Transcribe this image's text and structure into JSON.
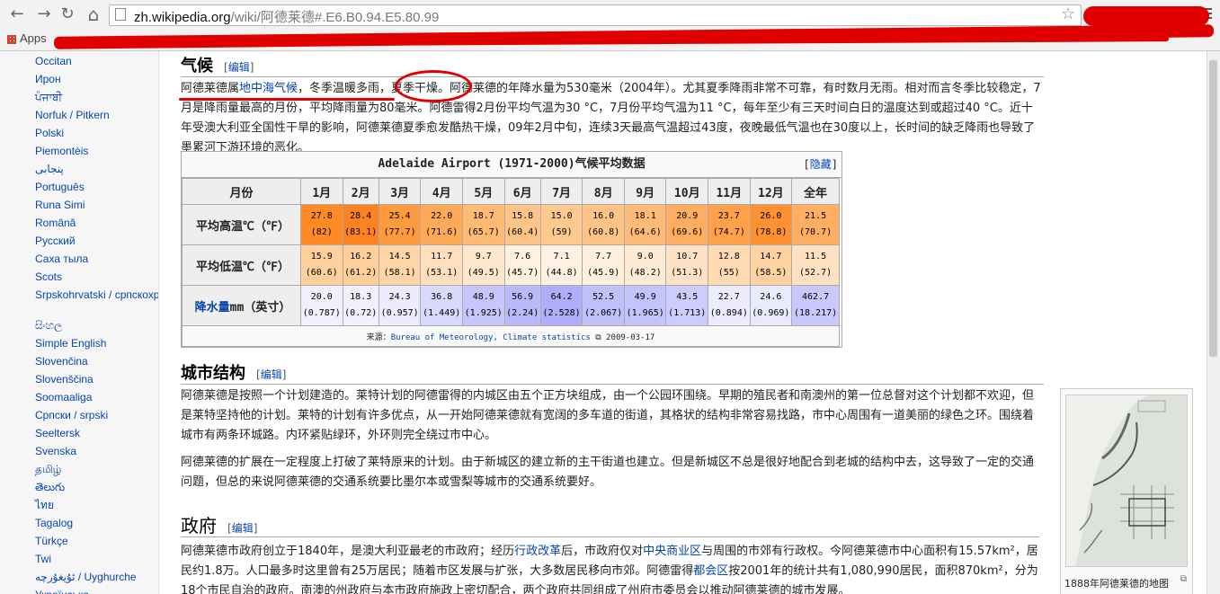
{
  "browser": {
    "url_host": "zh.wikipedia.org",
    "url_path": "/wiki/阿德莱德#.E6.B0.94.E5.80.99",
    "bookmarks_apps": "Apps",
    "back": "←",
    "forward": "→",
    "reload": "↻",
    "home": "⌂",
    "star": "☆"
  },
  "sidebar": {
    "languages": [
      "Occitan",
      "Ирон",
      "ਪੰਜਾਬੀ",
      "Norfuk / Pitkern",
      "Polski",
      "Piemontèis",
      "پنجابی",
      "Português",
      "Runa Simi",
      "Română",
      "Русский",
      "Саха тыла",
      "Scots",
      "Srpskohrvatski / српскохрватски",
      "සිංහල",
      "Simple English",
      "Slovenčina",
      "Slovenščina",
      "Soomaaliga",
      "Српски / srpski",
      "Seeltersk",
      "Svenska",
      "தமிழ்",
      "తెలుగు",
      "ไทย",
      "Tagalog",
      "Türkçe",
      "Twi",
      "ئۇيغۇرچە / Uyghurche",
      "Українська"
    ]
  },
  "content": {
    "climate_heading": "气候",
    "edit_label": "编辑",
    "climate_para": {
      "p1": "阿德莱德属",
      "link": "地中海气候",
      "p2": "，冬季温暖多雨，夏季干燥。阿德莱德的年降水量为530毫米（2004年）。尤其夏季降雨非常不可靠，有时数月无雨。相对而言冬季比较稳定，7月是降雨量最高的月份，平均降雨量为80毫米。阿德雷得2月份平均气温为30 °C，7月份平均气温为11 °C，每年至少有三天时间白日的温度达到或超过40 °C。近十年受澳大利亚全国性干旱的影响，阿德莱德夏季愈发酷热干燥，09年2月中旬，连续3天最高气温超过43度，夜晚最低气温也在30度以上，长时间的缺乏降雨也导致了墨累河下游环境的恶化。"
    },
    "city_heading": "城市结构",
    "city_para1": "阿德莱德是按照一个计划建造的。莱特计划的阿德雷得的内城区由五个正方块组成，由一个公园环围绕。早期的殖民者和南澳州的第一位总督对这个计划都不欢迎，但是莱特坚持他的计划。莱特的计划有许多优点，从一开始阿德莱德就有宽阔的多车道的街道，其格状的结构非常容易找路，市中心周围有一道美丽的绿色之环。围绕着城市有两条环城路。内环紧贴绿环，外环则完全绕过市中心。",
    "city_para2": "阿德莱德的扩展在一定程度上打破了莱特原来的计划。由于新城区的建立新的主干街道也建立。但是新城区不总是很好地配合到老城的结构中去，这导致了一定的交通问题，但总的来说阿德莱德的交通系统要比墨尔本或雪梨等城市的交通系统要好。",
    "gov_heading": "政府",
    "gov_para": {
      "a": "阿德莱德市政府创立于1840年，是澳大利亚最老的市政府；经历",
      "l1": "行政改革",
      "b": "后，市政府仅对",
      "l2": "中央商业区",
      "c": "与周围的市郊有行政权。今阿德莱德市中心面积有15.57km²，居民约1.8万。人口最多时这里曾有25万居民；随着市区发展与扩张，大多数居民移向市郊。阿德雷得",
      "l3": "都会区",
      "d": "按2001年的统计共有1,080,990居民，面积870km²，分为18个市民自治的政府。南澳的州政府与本市政府施政上密切配合，两个政府共同组成了州府市委员会以推动阿德莱德的城市发展。"
    },
    "thumb_caption": "1888年阿德莱德的地图"
  },
  "climate_table": {
    "title": "Adelaide Airport (1971-2000)气候平均数据",
    "hide_label": "隐藏",
    "month_header": "月份",
    "months": [
      "1月",
      "2月",
      "3月",
      "4月",
      "5月",
      "6月",
      "7月",
      "8月",
      "9月",
      "10月",
      "11月",
      "12月",
      "全年"
    ],
    "rows": [
      {
        "label": "平均高温℃（℉）",
        "values": [
          "27.8",
          "28.4",
          "25.4",
          "22.0",
          "18.7",
          "15.8",
          "15.0",
          "16.0",
          "18.1",
          "20.9",
          "23.7",
          "26.0",
          "21.5"
        ],
        "sub": [
          "(82)",
          "(83.1)",
          "(77.7)",
          "(71.6)",
          "(65.7)",
          "(60.4)",
          "(59)",
          "(60.8)",
          "(64.6)",
          "(69.6)",
          "(74.7)",
          "(78.8)",
          "(70.7)"
        ]
      },
      {
        "label": "平均低温℃（℉）",
        "values": [
          "15.9",
          "16.2",
          "14.5",
          "11.7",
          "9.7",
          "7.6",
          "7.1",
          "7.7",
          "9.0",
          "10.7",
          "12.8",
          "14.7",
          "11.5"
        ],
        "sub": [
          "(60.6)",
          "(61.2)",
          "(58.1)",
          "(53.1)",
          "(49.5)",
          "(45.7)",
          "(44.8)",
          "(45.9)",
          "(48.2)",
          "(51.3)",
          "(55)",
          "(58.5)",
          "(52.7)"
        ]
      },
      {
        "label": "降水量mm（英寸）",
        "label_link": "降水量",
        "label_rest": "mm（英寸）",
        "values": [
          "20.0",
          "18.3",
          "24.3",
          "36.8",
          "48.9",
          "56.9",
          "64.2",
          "52.5",
          "49.9",
          "43.5",
          "22.7",
          "24.6",
          "462.7"
        ],
        "sub": [
          "(0.787)",
          "(0.72)",
          "(0.957)",
          "(1.449)",
          "(1.925)",
          "(2.24)",
          "(2.528)",
          "(2.067)",
          "(1.965)",
          "(1.713)",
          "(0.894)",
          "(0.969)",
          "(18.217)"
        ]
      }
    ],
    "colors": {
      "high": [
        "#ff8a26",
        "#ff8221",
        "#ff9a3f",
        "#ffaa59",
        "#ffba73",
        "#ffc588",
        "#ffc98f",
        "#ffc486",
        "#ffbb77",
        "#ffad60",
        "#ffa04b",
        "#ff9132",
        "#ffae62"
      ],
      "low": [
        "#ffcf9c",
        "#ffce99",
        "#ffd4a7",
        "#ffdfbe",
        "#ffe7ce",
        "#fff0df",
        "#fff1e2",
        "#ffefdd",
        "#ffead4",
        "#ffe2c5",
        "#ffdab3",
        "#ffd2a2",
        "#ffe0c0"
      ],
      "rain": [
        "#f0f0fe",
        "#f1f1fe",
        "#ececfe",
        "#d9d9fd",
        "#c6c6fc",
        "#babafb",
        "#aeaefa",
        "#c0c0fb",
        "#c4c4fc",
        "#cccdfc",
        "#ececfe",
        "#eaeafe",
        "#c8c8fc"
      ]
    },
    "source_label": "来源：",
    "source_link": "Bureau of Meteorology, Climate statistics",
    "source_date": "2009-03-17"
  }
}
